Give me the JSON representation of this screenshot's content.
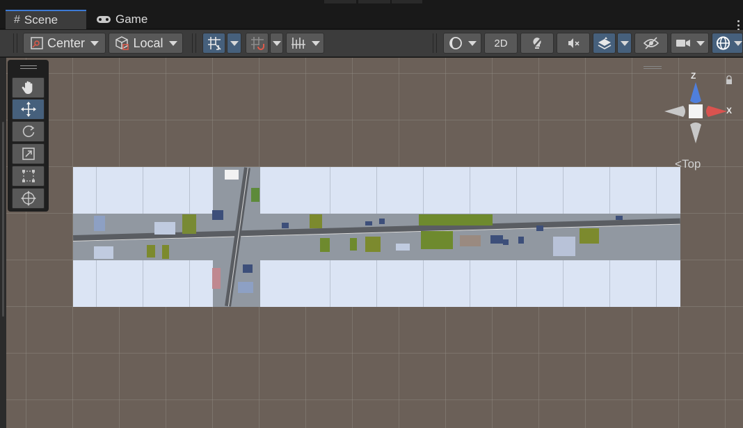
{
  "tabs": [
    {
      "label": "Scene",
      "icon": "grid-hash-icon",
      "active": true
    },
    {
      "label": "Game",
      "icon": "gamepad-icon",
      "active": false
    }
  ],
  "toolbar": {
    "pivot_mode": "Center",
    "pivot_rotation": "Local",
    "two_d_label": "2D"
  },
  "tools": [
    "hand-tool",
    "move-tool",
    "rotate-tool",
    "scale-tool",
    "rect-tool",
    "transform-tool"
  ],
  "active_tool": "move-tool",
  "gizmo": {
    "z_label": "Z",
    "x_label": "X",
    "view_label": "Top"
  },
  "colors": {
    "accent": "#46607c",
    "axis_x": "#d9534f",
    "axis_z": "#4f7fdc",
    "tab_highlight": "#3d7ad6"
  }
}
